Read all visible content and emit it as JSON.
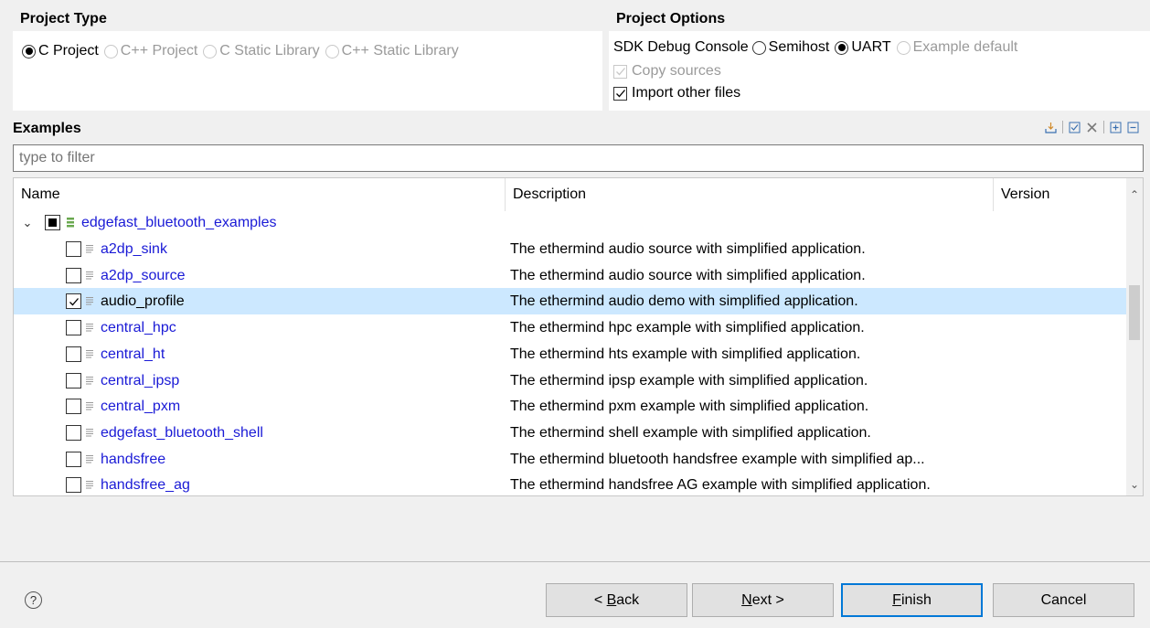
{
  "project_type": {
    "title": "Project Type",
    "options": [
      {
        "label": "C Project",
        "selected": true,
        "enabled": true
      },
      {
        "label": "C++ Project",
        "selected": false,
        "enabled": false
      },
      {
        "label": "C Static Library",
        "selected": false,
        "enabled": false
      },
      {
        "label": "C++ Static Library",
        "selected": false,
        "enabled": false
      }
    ]
  },
  "project_options": {
    "title": "Project Options",
    "sdk_console_label": "SDK Debug Console",
    "console_options": [
      {
        "label": "Semihost",
        "selected": false,
        "enabled": true
      },
      {
        "label": "UART",
        "selected": true,
        "enabled": true
      },
      {
        "label": "Example default",
        "selected": false,
        "enabled": false
      }
    ],
    "copy_sources": {
      "label": "Copy sources",
      "checked": true,
      "enabled": false
    },
    "import_other": {
      "label": "Import other files",
      "checked": true,
      "enabled": true
    }
  },
  "examples": {
    "title": "Examples",
    "filter_placeholder": "type to filter",
    "columns": {
      "name": "Name",
      "description": "Description",
      "version": "Version"
    },
    "group": {
      "label": "edgefast_bluetooth_examples",
      "expanded": true
    },
    "rows": [
      {
        "name": "a2dp_sink",
        "description": "The ethermind audio source with simplified application.",
        "checked": false,
        "selected": false
      },
      {
        "name": "a2dp_source",
        "description": "The ethermind audio source with simplified application.",
        "checked": false,
        "selected": false
      },
      {
        "name": "audio_profile",
        "description": "The ethermind audio demo with simplified application.",
        "checked": true,
        "selected": true
      },
      {
        "name": "central_hpc",
        "description": "The ethermind hpc example with simplified application.",
        "checked": false,
        "selected": false
      },
      {
        "name": "central_ht",
        "description": "The ethermind hts example with simplified application.",
        "checked": false,
        "selected": false
      },
      {
        "name": "central_ipsp",
        "description": "The ethermind ipsp example with simplified application.",
        "checked": false,
        "selected": false
      },
      {
        "name": "central_pxm",
        "description": "The ethermind pxm example with simplified application.",
        "checked": false,
        "selected": false
      },
      {
        "name": "edgefast_bluetooth_shell",
        "description": "The ethermind shell example with simplified application.",
        "checked": false,
        "selected": false
      },
      {
        "name": "handsfree",
        "description": "The ethermind bluetooth handsfree example with simplified ap...",
        "checked": false,
        "selected": false
      },
      {
        "name": "handsfree_ag",
        "description": "The ethermind handsfree AG example with simplified application.",
        "checked": false,
        "selected": false
      }
    ]
  },
  "footer": {
    "help": "?",
    "back_label": "< Back",
    "next_label": "Next >",
    "finish_label": "Finish",
    "cancel_label": "Cancel"
  },
  "colors": {
    "link": "#1a1ad6",
    "selection": "#cce8ff",
    "default_button_border": "#0078d7"
  }
}
